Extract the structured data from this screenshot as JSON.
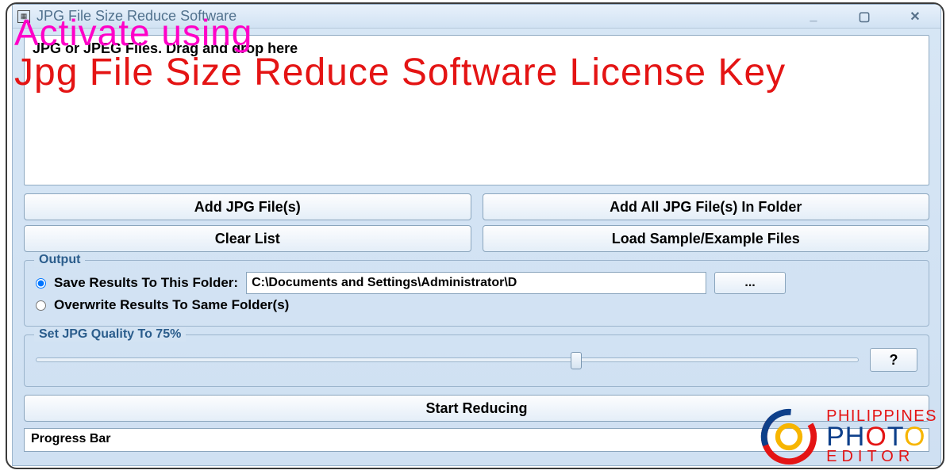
{
  "title": "JPG File Size Reduce Software",
  "listbox": {
    "placeholder": "JPG or JPEG Files. Drag and drop here"
  },
  "buttons": {
    "add_files": "Add JPG File(s)",
    "add_folder": "Add All JPG File(s) In Folder",
    "clear_list": "Clear List",
    "load_sample": "Load Sample/Example Files",
    "browse": "...",
    "help": "?",
    "start": "Start Reducing"
  },
  "output": {
    "legend": "Output",
    "save_to_label": "Save Results To This Folder:",
    "save_to_path": "C:\\Documents and Settings\\Administrator\\D",
    "overwrite_label": "Overwrite Results To Same Folder(s)",
    "selected": "save"
  },
  "quality": {
    "legend": "Set JPG Quality To 75%",
    "value": 75,
    "thumb_left_pct": 65
  },
  "progress": {
    "label": "Progress Bar"
  },
  "overlay": {
    "line1": "Activate using",
    "line2": "Jpg File Size Reduce Software License Key"
  },
  "watermark": {
    "line1": "PHILIPPINES",
    "line2": "PHOTO",
    "line3": "EDITOR"
  },
  "win_controls": {
    "min": "_",
    "max": "▢",
    "close": "✕"
  }
}
